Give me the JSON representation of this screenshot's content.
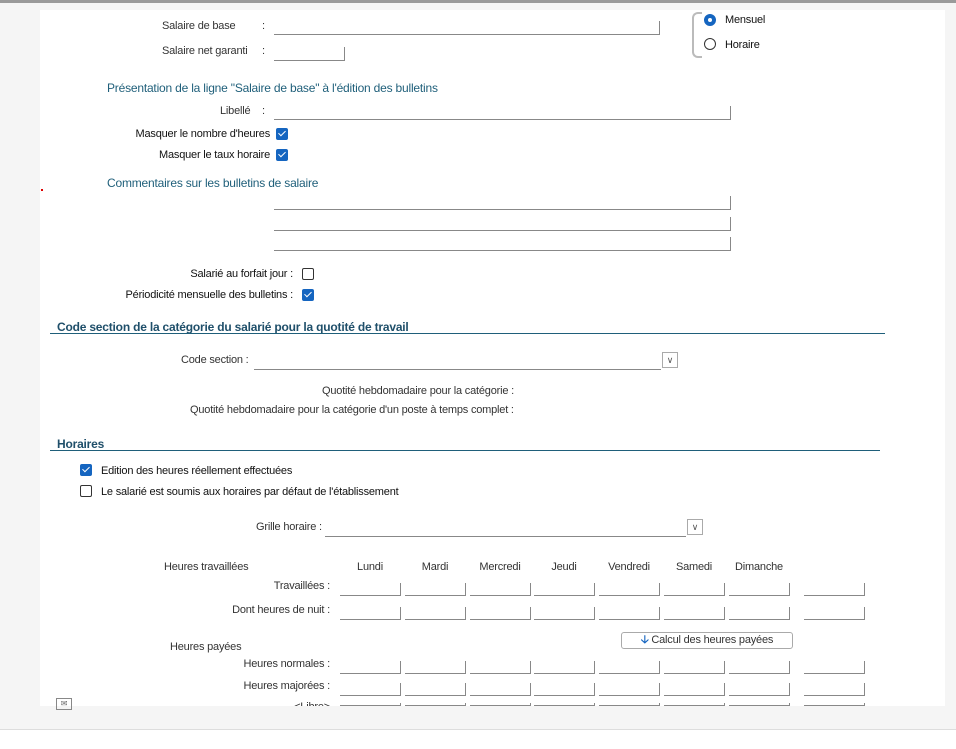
{
  "salary": {
    "base_label": "Salaire de base",
    "net_label": "Salaire net garanti",
    "sep": ":"
  },
  "period": {
    "options": [
      {
        "label": "Mensuel",
        "selected": true
      },
      {
        "label": "Horaire",
        "selected": false
      }
    ]
  },
  "presentation": {
    "title": "Présentation de la ligne \"Salaire de base\" à l'édition des bulletins",
    "libelle_label": "Libellé",
    "mask_hours_label": "Masquer le nombre d'heures",
    "mask_hours": true,
    "mask_rate_label": "Masquer le taux horaire",
    "mask_rate": true
  },
  "comments": {
    "title": "Commentaires sur les bulletins de salaire"
  },
  "forfait": {
    "label": "Salarié au forfait jour :",
    "checked": false
  },
  "periodicite": {
    "label": "Périodicité mensuelle des bulletins :",
    "checked": true
  },
  "code_section": {
    "title": "Code section de la catégorie du salarié pour la quotité de travail",
    "label": "Code section :",
    "quotite1": "Quotité hebdomadaire pour la catégorie :",
    "quotite2": "Quotité hebdomadaire pour la catégorie d'un poste à temps complet :"
  },
  "horaires": {
    "title": "Horaires",
    "edition_label": "Edition des heures réellement effectuées",
    "edition": true,
    "defaut_label": "Le salarié est soumis aux horaires par défaut de l'établissement",
    "defaut": false,
    "grille_label": "Grille horaire :"
  },
  "hours": {
    "worked_title": "Heures travaillées",
    "paid_title": "Heures payées",
    "days": [
      "Lundi",
      "Mardi",
      "Mercredi",
      "Jeudi",
      "Vendredi",
      "Samedi",
      "Dimanche"
    ],
    "rows": [
      "Travaillées :",
      "Dont heures de nuit :",
      "Heures normales :",
      "Heures majorées :",
      "<Libre>"
    ],
    "calc_button": "Calcul des heures payées"
  },
  "colors": {
    "accent": "#1565c0",
    "heading": "#1f5f7a"
  }
}
